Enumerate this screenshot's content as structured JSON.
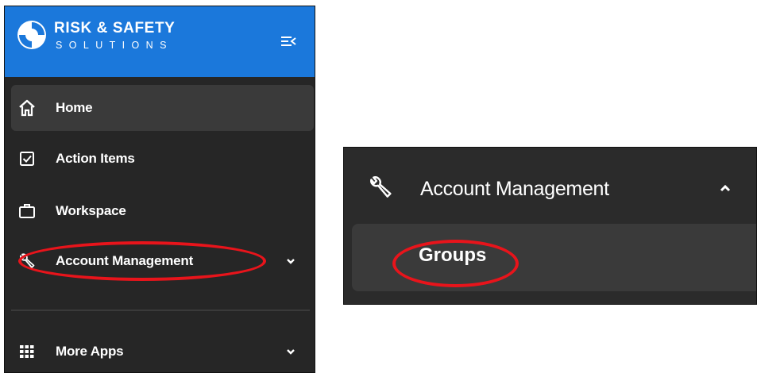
{
  "brand": {
    "name": "RISK & SAFETY",
    "sub": "SOLUTIONS",
    "color": "#1b78db"
  },
  "sidebar": {
    "items": [
      {
        "label": "Home",
        "icon": "home-icon",
        "active": true
      },
      {
        "label": "Action Items",
        "icon": "checkbox-icon"
      },
      {
        "label": "Workspace",
        "icon": "briefcase-icon"
      },
      {
        "label": "Account Management",
        "icon": "wrench-icon",
        "expandable": true,
        "expanded": false
      },
      {
        "label": "More Apps",
        "icon": "grid-icon",
        "expandable": true,
        "expanded": false
      }
    ]
  },
  "zoom": {
    "header": {
      "label": "Account Management",
      "icon": "wrench-icon",
      "expanded": true
    },
    "submenu": [
      {
        "label": "Groups"
      }
    ]
  },
  "annotation_color": "#e8141b"
}
